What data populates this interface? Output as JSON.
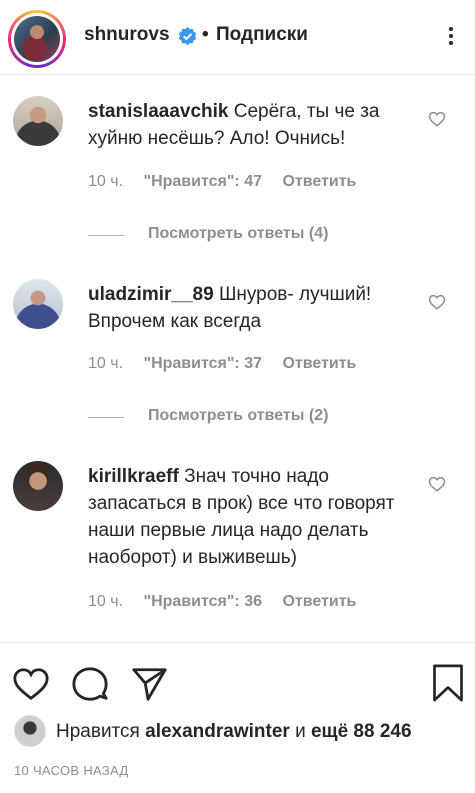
{
  "header": {
    "username": "shnurovs",
    "separator": "•",
    "follow_label": "Подписки"
  },
  "comments": [
    {
      "username": "stanislaaavchik",
      "text": " Серёга, ты че за хуйню несёшь? Ало! Очнись!",
      "time": "10 ч.",
      "likes": "\"Нравится\": 47",
      "reply_label": "Ответить",
      "view_replies": "Посмотреть ответы (4)"
    },
    {
      "username": "uladzimir__89",
      "text": " Шнуров- лучший! Впрочем как всегда",
      "time": "10 ч.",
      "likes": "\"Нравится\": 37",
      "reply_label": "Ответить",
      "view_replies": "Посмотреть ответы (2)"
    },
    {
      "username": "kirillkraeff",
      "text": " Знач точно надо запасаться в прок) все что говорят наши первые лица надо делать наоборот) и выживешь)",
      "time": "10 ч.",
      "likes": "\"Нравится\": 36",
      "reply_label": "Ответить"
    }
  ],
  "likes": {
    "prefix": "Нравится ",
    "user": "alexandrawinter",
    "middle": " и ",
    "count": "ещё 88 246"
  },
  "timestamp": "10 ЧАСОВ НАЗАД",
  "icons": [
    "verified-icon",
    "more-icon",
    "heart-icon",
    "comment-icon",
    "share-icon",
    "save-icon"
  ],
  "colors": {
    "verified": "#3897f0",
    "muted": "#8e8e8e",
    "text": "#262626"
  }
}
